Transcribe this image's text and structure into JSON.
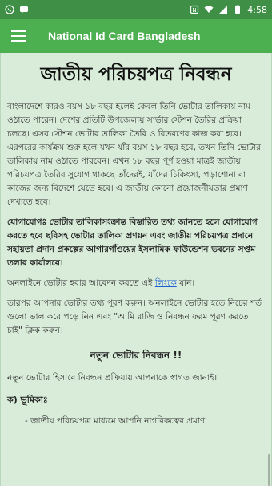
{
  "status_bar": {
    "time": "4:58"
  },
  "app_bar": {
    "title": "National Id Card Bangladesh"
  },
  "content": {
    "heading": "জাতীয় পরিচয়পত্র নিবন্ধন",
    "para1": "বাংলাদেশে কারও বয়স ১৮ বছর হলেই কেবল তিনি ভোটার তালিকায় নাম ওঠাতে পারেন। দেশের প্রতিটি উপজেলায় সার্ভার স্টেশন তৈরির প্রক্রিয়া চলছে। এসব স্টেশন ভোটার তালিকা তৈরি ও বিতরণের কাজ করা হবে। এরপরের কার্যক্রম শুরু হলে যখন যাঁর বয়স ১৮ বছর হবে, তখন তিনি ভোটার তালিকায় নাম ওঠাতে পারবেন। এখন ১৮ বছর পূর্ণ হওয়া মাত্রই জাতীয় পরিচয়পত্র তৈরির সুযোগ থাকছে তাঁদেরই, যাঁদের চিকিৎসা, পড়াশোনা বা কাজের জন্য বিদেশে যেতে হবে। এ জাতীয় কোনো প্রয়োজনীয়তার প্রমাণ দেখাতে হবে।",
    "para2": "যোগাযোগঃ ভোটার তালিকাসংক্রান্ত বিস্তারিত তথ্য জানতে হলে যোগাযোগ করতে হবে ছবিসহ ভোটার তালিকা প্রণয়ন এবং জাতীয় পরিচয়পত্র প্রদানে সহায়তা প্রদান প্রকল্পের আগারগাঁওয়ের ইসলামিক ফাউন্ডেশন ভবনের সপ্তম তলার কার্যালয়ে।",
    "para3_before": "অনলাইনে ভোটার হবার আবেদন করতে এই ",
    "para3_link": "লিংকে",
    "para3_after": " যান।",
    "para4": "তারপর আপনার ভোটার তথ্য পূরণ করুন। অনলাইনে ভোটার হতে নিচের শর্ত গুলো ভাল করে পড়ে নিন এবং \"আমি রাজি ও নিবন্ধন ফরম পূরণ করতে চাই\" ক্লিক করুন।",
    "subhead": "নতুন ভোটার নিবন্ধন !!",
    "para5": "নতুন ভোটার হিসাবে নিবন্ধন প্রক্রিয়ায় আপনাকে স্বাগত জানাই।",
    "section_label": "ক) ভূমিকাঃ",
    "cut_line": "- জাতীয় পরিচয়পত্র মাধ্যমে আপনি নাগরিকত্বের প্রমাণ"
  }
}
